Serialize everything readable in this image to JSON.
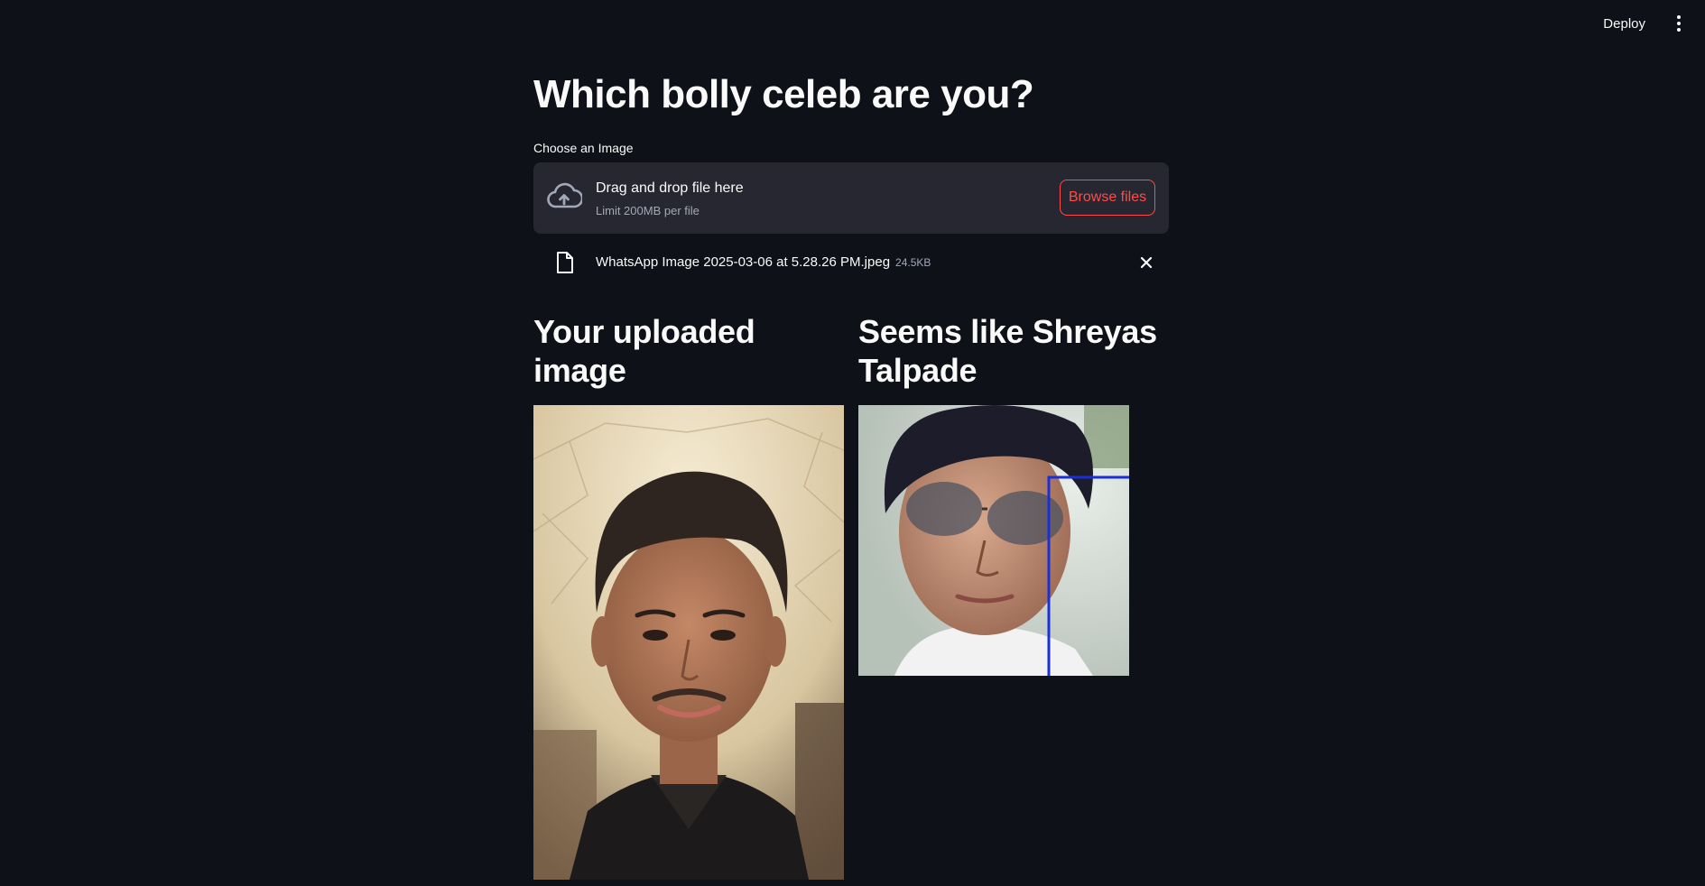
{
  "header": {
    "deploy_label": "Deploy",
    "menu_icon": "kebab-menu-icon"
  },
  "page": {
    "title": "Which bolly celeb are you?"
  },
  "uploader": {
    "label": "Choose an Image",
    "drop_text": "Drag and drop file here",
    "limit_text": "Limit 200MB per file",
    "browse_label": "Browse files",
    "icon": "cloud-upload-icon",
    "accent_color": "#ff4b4b"
  },
  "uploaded_file": {
    "name": "WhatsApp Image 2025-03-06 at 5.28.26 PM.jpeg",
    "size": "24.5KB",
    "icon": "file-icon",
    "remove_icon": "close-icon"
  },
  "results": {
    "left_heading": "Your uploaded image",
    "right_heading": "Seems like Shreyas Talpade"
  },
  "theme": {
    "background": "#0e1117",
    "surface": "#262730",
    "text": "#fafafa",
    "muted_text": "#a3a8b8"
  }
}
